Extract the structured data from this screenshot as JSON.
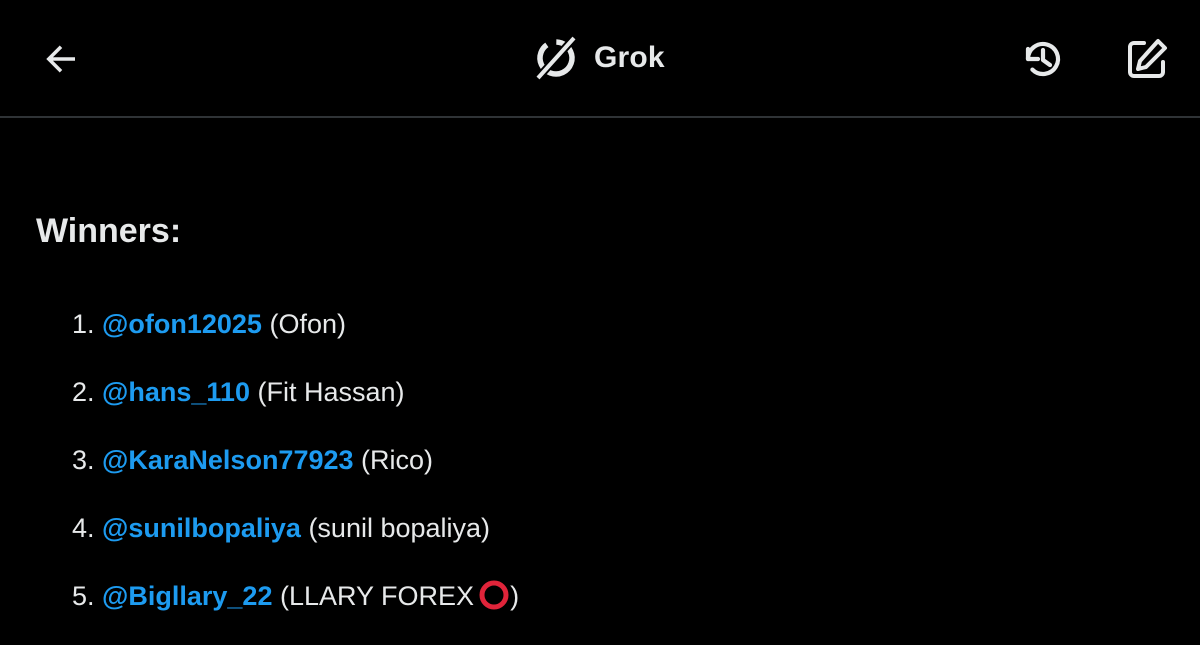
{
  "header": {
    "title": "Grok",
    "back_icon": "arrow-left-icon",
    "logo_icon": "grok-logo-icon",
    "history_icon": "history-icon",
    "compose_icon": "compose-icon"
  },
  "message": {
    "heading": "Winners:",
    "winners": [
      {
        "number": "1.",
        "handle": "@ofon12025",
        "display": "(Ofon)"
      },
      {
        "number": "2.",
        "handle": "@hans_110",
        "display": "(Fit Hassan)"
      },
      {
        "number": "3.",
        "handle": "@KaraNelson77923",
        "display": "(Rico)"
      },
      {
        "number": "4.",
        "handle": "@sunilbopaliya",
        "display": "(sunil bopaliya)"
      },
      {
        "number": "5.",
        "handle": "@Bigllary_22",
        "display_before": "(LLARY FOREX",
        "display_after": ")",
        "emoji": "hollow-red-circle"
      }
    ]
  },
  "colors": {
    "background": "#000000",
    "text": "#e7e9ea",
    "link": "#1d9bf0",
    "divider": "#2f3336",
    "ring": "#e0243a"
  }
}
